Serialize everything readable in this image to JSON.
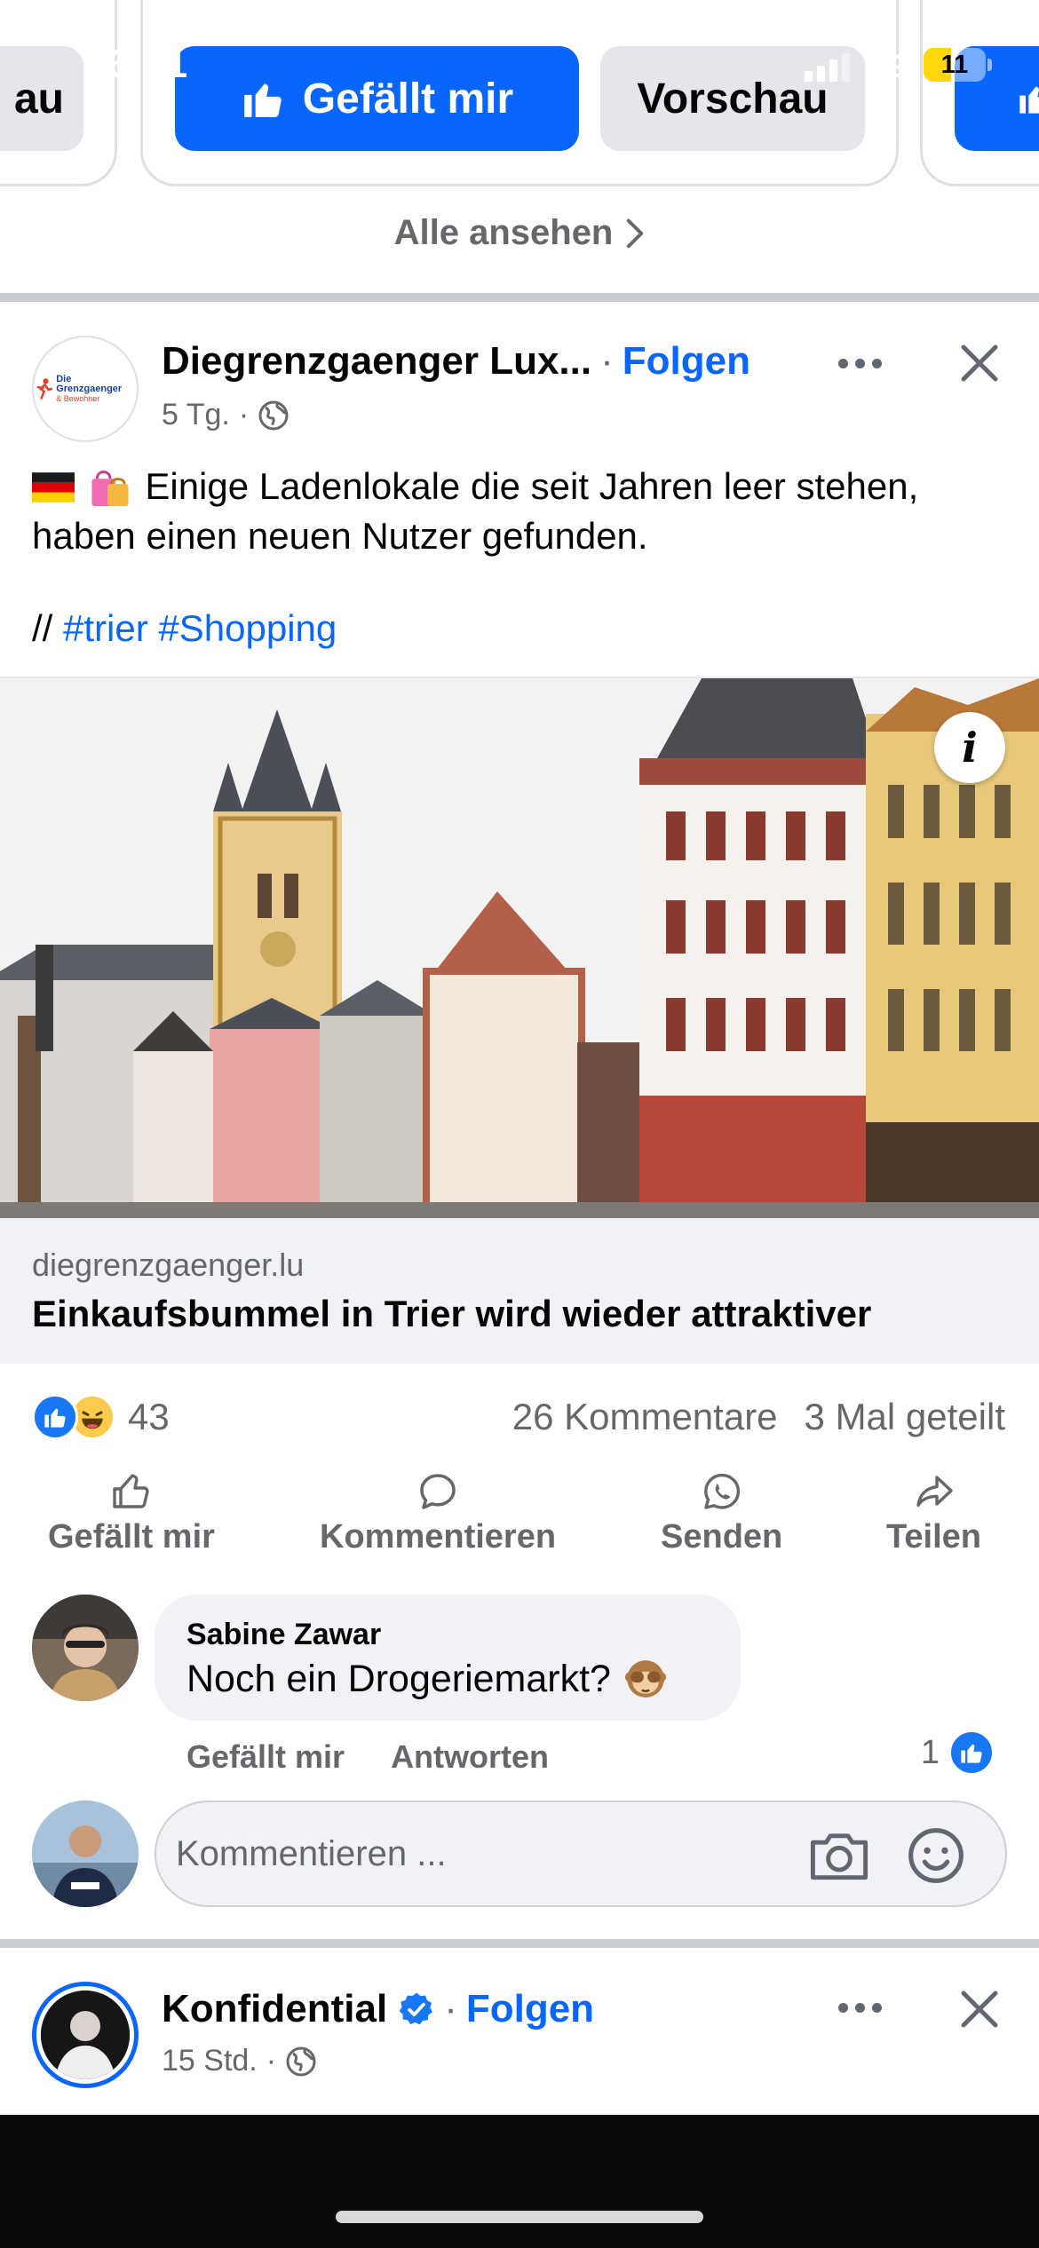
{
  "status_bar": {
    "time": "16:41",
    "network": "4G",
    "battery_level": "11",
    "battery_fraction": 0.11,
    "battery_color": "#ffd60a"
  },
  "carousel": {
    "left_pill_label": "au",
    "like_button_label": "Gefällt mir",
    "preview_button_label": "Vorschau",
    "see_all_label": "Alle ansehen"
  },
  "post": {
    "page_name": "Diegrenzgaenger Lux...",
    "separator": "·",
    "follow_label": "Folgen",
    "time_ago": "5 Tg.",
    "meta_separator": "·",
    "text": "Einige Ladenlokale die seit Jahren leer stehen, haben einen neuen Nutzer gefunden.",
    "emojis": [
      "german-flag-icon",
      "shopping-bags-icon"
    ],
    "hashtag_prefix": "//",
    "hashtags": [
      "#trier",
      "#Shopping"
    ],
    "avatar_logo_text": [
      "Die Grenzgaenger",
      "& Bewohner"
    ],
    "link": {
      "domain": "diegrenzgaenger.lu",
      "title": "Einkaufsbummel in Trier wird wieder attraktiver"
    },
    "info_button_label": "i",
    "reaction_icons": [
      "like-reaction-icon",
      "haha-reaction-icon"
    ],
    "reactions_count": "43",
    "comments_count": "26 Kommentare",
    "shares_count": "3 Mal geteilt",
    "actions": {
      "like": "Gefällt mir",
      "comment": "Kommentieren",
      "send": "Senden",
      "share": "Teilen"
    }
  },
  "comment": {
    "author": "Sabine Zawar",
    "text": "Noch ein Drogeriemarkt?",
    "emoji": "see-no-evil-monkey-icon",
    "like_label": "Gefällt mir",
    "reply_label": "Antworten",
    "likes_count": "1"
  },
  "comment_input": {
    "placeholder": "Kommentieren ..."
  },
  "next_post": {
    "page_name": "Konfidential",
    "separator": "·",
    "follow_label": "Folgen",
    "time_ago": "15 Std.",
    "meta_separator": "·",
    "verified": true
  },
  "colors": {
    "accent": "#0866ff",
    "secondary_text": "#65676b",
    "surface": "#f0f2f5",
    "reaction_like": "#1877f2",
    "reaction_haha": "#fccb4e"
  }
}
